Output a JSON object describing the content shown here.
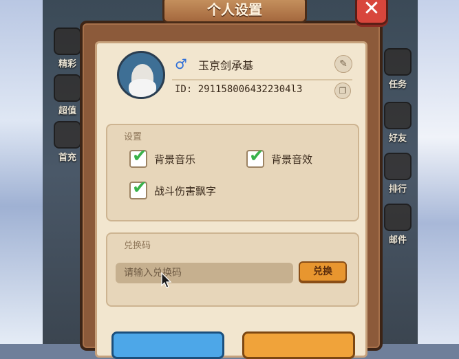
{
  "panel": {
    "title": "个人设置",
    "close_label": "✕"
  },
  "profile": {
    "gender_symbol": "♂",
    "name": "玉京剑承基",
    "id_text": "ID: 2911580064322304l3"
  },
  "settings": {
    "section_label": "设置",
    "options": [
      {
        "label": "背景音乐",
        "checked": true
      },
      {
        "label": "背景音效",
        "checked": true
      },
      {
        "label": "战斗伤害飘字",
        "checked": true
      }
    ]
  },
  "redeem": {
    "section_label": "兑换码",
    "placeholder": "请输入兑换码",
    "button_label": "兑换"
  },
  "side_left": [
    {
      "label": "精彩"
    },
    {
      "label": "超值"
    },
    {
      "label": "首充"
    }
  ],
  "side_right": [
    {
      "label": "任务"
    },
    {
      "label": "好友"
    },
    {
      "label": "排行"
    },
    {
      "label": "邮件"
    }
  ],
  "colors": {
    "panel_wood": "#8c5a3a",
    "parchment": "#f2e6cf",
    "check_green": "#39b24a",
    "redeem_orange": "#e8962f",
    "close_red": "#d8463c"
  }
}
